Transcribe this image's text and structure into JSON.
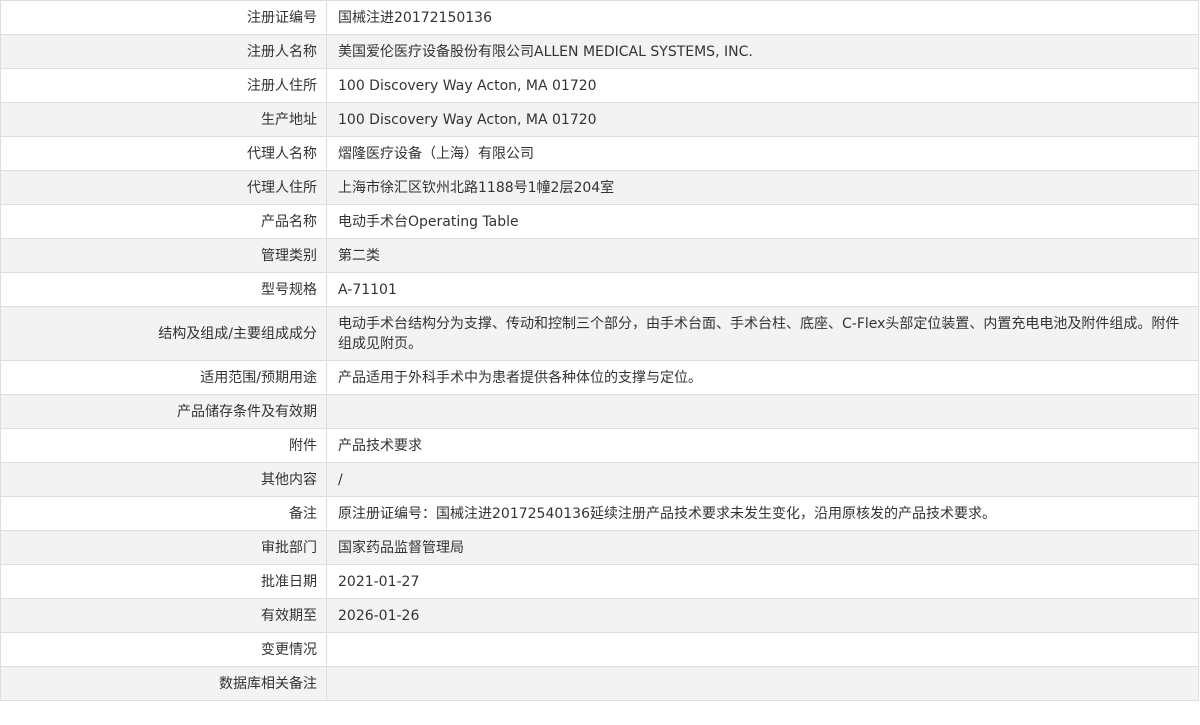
{
  "record": {
    "rows": [
      {
        "label": "注册证编号",
        "value": "国械注进20172150136"
      },
      {
        "label": "注册人名称",
        "value": "美国爱伦医疗设备股份有限公司ALLEN MEDICAL SYSTEMS, INC."
      },
      {
        "label": "注册人住所",
        "value": "100 Discovery Way Acton, MA 01720"
      },
      {
        "label": "生产地址",
        "value": "100 Discovery Way Acton, MA 01720"
      },
      {
        "label": "代理人名称",
        "value": "熠隆医疗设备（上海）有限公司"
      },
      {
        "label": "代理人住所",
        "value": "上海市徐汇区钦州北路1188号1幢2层204室"
      },
      {
        "label": "产品名称",
        "value": "电动手术台Operating Table"
      },
      {
        "label": "管理类别",
        "value": "第二类"
      },
      {
        "label": "型号规格",
        "value": "A-71101"
      },
      {
        "label": "结构及组成/主要组成成分",
        "value": "电动手术台结构分为支撑、传动和控制三个部分，由手术台面、手术台柱、底座、C-Flex头部定位装置、内置充电电池及附件组成。附件组成见附页。"
      },
      {
        "label": "适用范围/预期用途",
        "value": "产品适用于外科手术中为患者提供各种体位的支撑与定位。"
      },
      {
        "label": "产品储存条件及有效期",
        "value": ""
      },
      {
        "label": "附件",
        "value": "产品技术要求"
      },
      {
        "label": "其他内容",
        "value": "/"
      },
      {
        "label": "备注",
        "value": "原注册证编号：国械注进20172540136延续注册产品技术要求未发生变化，沿用原核发的产品技术要求。"
      },
      {
        "label": "审批部门",
        "value": "国家药品监督管理局"
      },
      {
        "label": "批准日期",
        "value": "2021-01-27"
      },
      {
        "label": "有效期至",
        "value": "2026-01-26"
      },
      {
        "label": "变更情况",
        "value": ""
      },
      {
        "label": "数据库相关备注",
        "value": ""
      }
    ]
  },
  "colors": {
    "border": "#dddddd",
    "row_alt_background": "#f3f3f3",
    "text": "#333333"
  }
}
